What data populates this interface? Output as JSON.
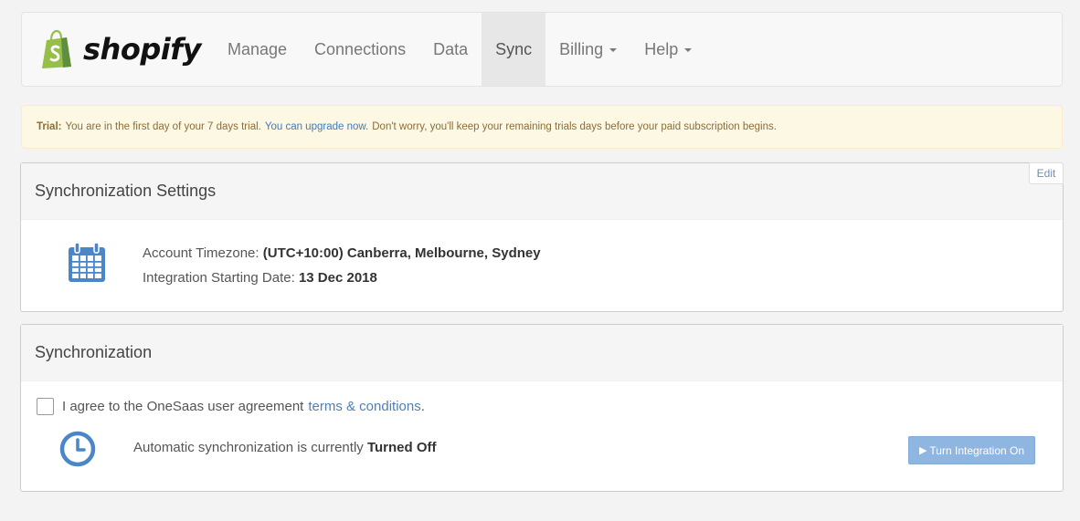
{
  "brand": {
    "name": "shopify",
    "color": "#95bf47"
  },
  "nav": {
    "items": [
      {
        "label": "Manage"
      },
      {
        "label": "Connections"
      },
      {
        "label": "Data"
      },
      {
        "label": "Sync"
      },
      {
        "label": "Billing"
      },
      {
        "label": "Help"
      }
    ],
    "active": "Sync"
  },
  "alert": {
    "label": "Trial:",
    "text1": "You are in the first day of your 7 days trial.",
    "link": "You can upgrade now.",
    "text2": "Don't worry, you'll keep your remaining trials days before your paid subscription begins."
  },
  "settings": {
    "title": "Synchronization Settings",
    "edit_label": "Edit",
    "timezone_label": "Account Timezone:",
    "timezone_value": "(UTC+10:00) Canberra, Melbourne, Sydney",
    "start_label": "Integration Starting Date:",
    "start_value": "13 Dec 2018",
    "icon": "calendar-icon"
  },
  "sync": {
    "title": "Synchronization",
    "agree_text": "I agree to the OneSaas user agreement",
    "agree_link": "terms & conditions",
    "agree_end": ".",
    "agree_checked": false,
    "status_text": "Automatic synchronization is currently",
    "status_value": "Turned Off",
    "button_label": "Turn Integration On",
    "icon": "clock-icon"
  },
  "colors": {
    "accent": "#3f7bbf",
    "button": "#8fb6e1",
    "alert_bg": "#fcf8e3"
  }
}
